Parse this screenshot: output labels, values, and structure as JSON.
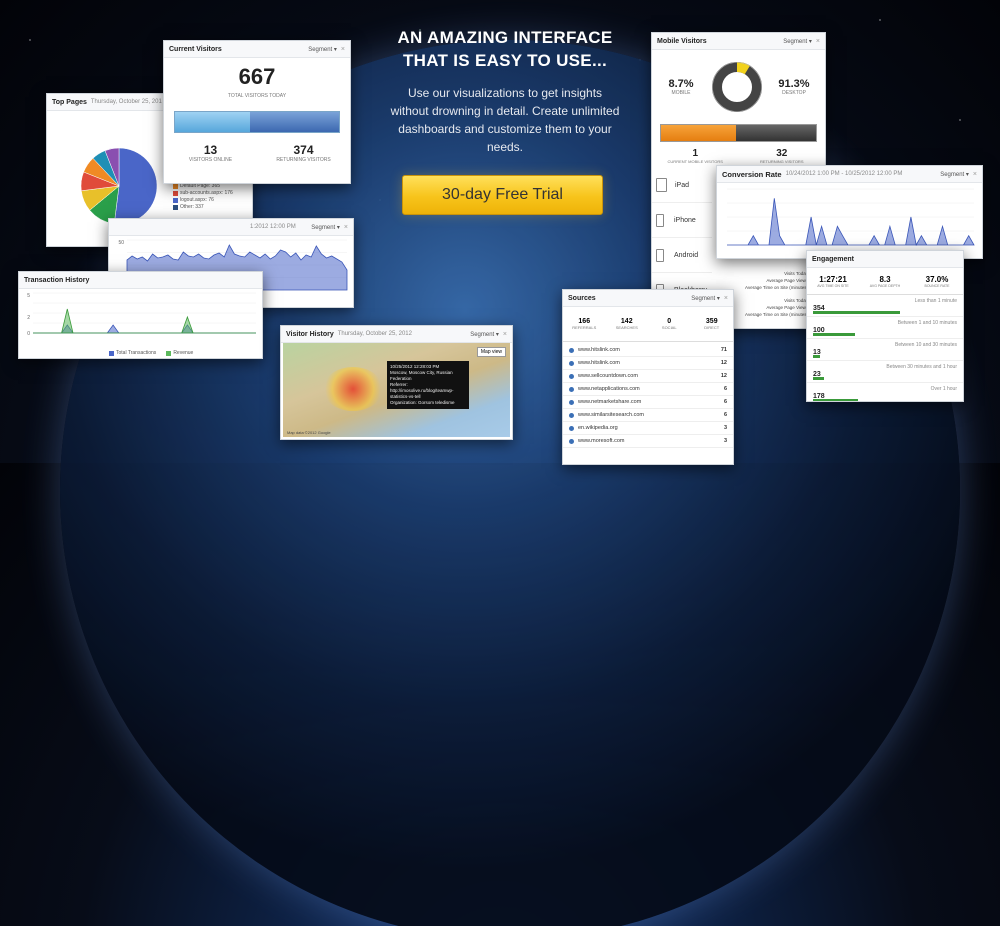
{
  "hero": {
    "title": "AN AMAZING INTERFACE THAT IS EASY TO USE...",
    "body": "Use our visualizations to get insights without drowning in detail. Create unlimited dashboards and customize them to your needs.",
    "cta": "30-day Free Trial"
  },
  "common": {
    "segment": "Segment ▾",
    "close": "×"
  },
  "top_pages": {
    "title": "Top Pages",
    "subtitle": "Thursday, October 25, 201",
    "legend": [
      "Default Page: 365",
      "sub-accounts.aspx: 176",
      "logout.aspx: 76",
      "Other: 337"
    ],
    "legend_colors": [
      "#f08a24",
      "#e04b3a",
      "#4a66c8",
      "#2d4e7e"
    ],
    "slices": [
      {
        "color": "#4a66c8",
        "value": 52
      },
      {
        "color": "#2a9f4a",
        "value": 12
      },
      {
        "color": "#e8c02a",
        "value": 9
      },
      {
        "color": "#e04b3a",
        "value": 8
      },
      {
        "color": "#f08a24",
        "value": 7
      },
      {
        "color": "#1f8fb5",
        "value": 6
      },
      {
        "color": "#8a4fb0",
        "value": 6
      }
    ]
  },
  "current_visitors": {
    "title": "Current Visitors",
    "total": "667",
    "total_label": "TOTAL VISITORS TODAY",
    "online": "13",
    "online_label": "VISITORS ONLINE",
    "returning": "374",
    "returning_label": "RETURNING VISITORS",
    "online_fraction": 0.46
  },
  "line_panel": {
    "subtitle": "1:2012 12:00 PM",
    "y_ticks": [
      "50",
      "0"
    ],
    "values": [
      30,
      34,
      31,
      33,
      29,
      36,
      32,
      33,
      35,
      31,
      30,
      38,
      34,
      33,
      36,
      32,
      31,
      35,
      37,
      33,
      45,
      36,
      34,
      33,
      38,
      35,
      32,
      36,
      31,
      34,
      40,
      38,
      33,
      37,
      30,
      35,
      33,
      44,
      36,
      32,
      34,
      31,
      28,
      20
    ]
  },
  "transaction_history": {
    "title": "Transaction History",
    "y_ticks": [
      "5",
      "2",
      "0"
    ],
    "legend_a": "Total Transactions",
    "legend_b": "Revenue",
    "transactions": [
      0,
      0,
      0,
      0,
      0,
      0,
      1,
      0,
      0,
      0,
      0,
      0,
      0,
      0,
      1,
      0,
      0,
      0,
      0,
      0,
      0,
      0,
      0,
      0,
      0,
      0,
      0,
      1,
      0,
      0,
      0,
      0,
      0,
      0,
      0,
      0,
      0,
      0,
      0,
      0
    ],
    "revenue": [
      0,
      0,
      0,
      0,
      0,
      0,
      3,
      0,
      0,
      0,
      0,
      0,
      0,
      0,
      0,
      0,
      0,
      0,
      0,
      0,
      0,
      0,
      0,
      0,
      0,
      0,
      0,
      2,
      0,
      0,
      0,
      0,
      0,
      0,
      0,
      0,
      0,
      0,
      0,
      0
    ]
  },
  "visitor_history": {
    "title": "Visitor History",
    "subtitle": "Thursday, October 25, 2012",
    "map_toggle": "Map view",
    "tooltip": [
      "10/25/2012 12:28:03 PM",
      "Moscow, Moscow City, Russian Federation",
      "Referrer:",
      "http://imosolive.ru/blog/teamwp-statistics-vs-tell",
      "Organization: Gorsom teledisme"
    ],
    "footer": "Map data ©2012 Google"
  },
  "mobile_visitors": {
    "title": "Mobile Visitors",
    "mobile_pct": "8.7%",
    "mobile_label": "MOBILE",
    "desktop_pct": "91.3%",
    "desktop_label": "DESKTOP",
    "mobile_fraction": 0.087,
    "current": "1",
    "current_label": "CURRENT MOBILE VISITORS",
    "returning": "32",
    "returning_label": "RETURNING VISITORS",
    "devices": [
      "iPad",
      "iPhone",
      "Android",
      "Blackberry"
    ],
    "stats": [
      "Visits Today",
      "Average Page Views",
      "Average Time on Site (minutes)"
    ]
  },
  "conversion_rate": {
    "title": "Conversion Rate",
    "subtitle": "10/24/2012 1:00 PM - 10/25/2012 12:00 PM",
    "values": [
      0,
      0,
      0,
      0,
      0,
      1,
      0,
      0,
      0,
      5,
      1,
      0,
      0,
      0,
      0,
      0,
      3,
      0,
      2,
      0,
      0,
      2,
      1,
      0,
      0,
      0,
      0,
      0,
      1,
      0,
      0,
      2,
      0,
      0,
      0,
      3,
      0,
      1,
      0,
      0,
      0,
      2,
      0,
      0,
      0,
      0,
      1,
      0
    ]
  },
  "sources": {
    "title": "Sources",
    "totals": [
      {
        "value": "166",
        "label": "REFERRALS"
      },
      {
        "value": "142",
        "label": "SEARCHES"
      },
      {
        "value": "0",
        "label": "SOCIAL"
      },
      {
        "value": "359",
        "label": "DIRECT"
      }
    ],
    "rows": [
      {
        "name": "www.hitslink.com",
        "count": "71"
      },
      {
        "name": "www.hitslink.com",
        "count": "12"
      },
      {
        "name": "www.sellcountdown.com",
        "count": "12"
      },
      {
        "name": "www.netapplications.com",
        "count": "6"
      },
      {
        "name": "www.netmarketshare.com",
        "count": "6"
      },
      {
        "name": "www.similarsitesearch.com",
        "count": "6"
      },
      {
        "name": "en.wikipedia.org",
        "count": "3"
      },
      {
        "name": "www.moresoft.com",
        "count": "3"
      }
    ]
  },
  "engagement": {
    "title": "Engagement",
    "summary": [
      {
        "value": "1:27:21",
        "label": "AVG TIME ON SITE"
      },
      {
        "value": "8.3",
        "label": "AVG PAGE DEPTH"
      },
      {
        "value": "37.0%",
        "label": "BOUNCE RATE"
      }
    ],
    "rows": [
      {
        "value": "354",
        "desc": "Less than 1 minute",
        "fraction": 0.62
      },
      {
        "value": "100",
        "desc": "Between 1 and 10 minutes",
        "fraction": 0.3
      },
      {
        "value": "13",
        "desc": "Between 10 and 30 minutes",
        "fraction": 0.05
      },
      {
        "value": "23",
        "desc": "Between 30 minutes and 1 hour",
        "fraction": 0.08
      },
      {
        "value": "178",
        "desc": "Over 1 hour",
        "fraction": 0.32
      }
    ]
  }
}
